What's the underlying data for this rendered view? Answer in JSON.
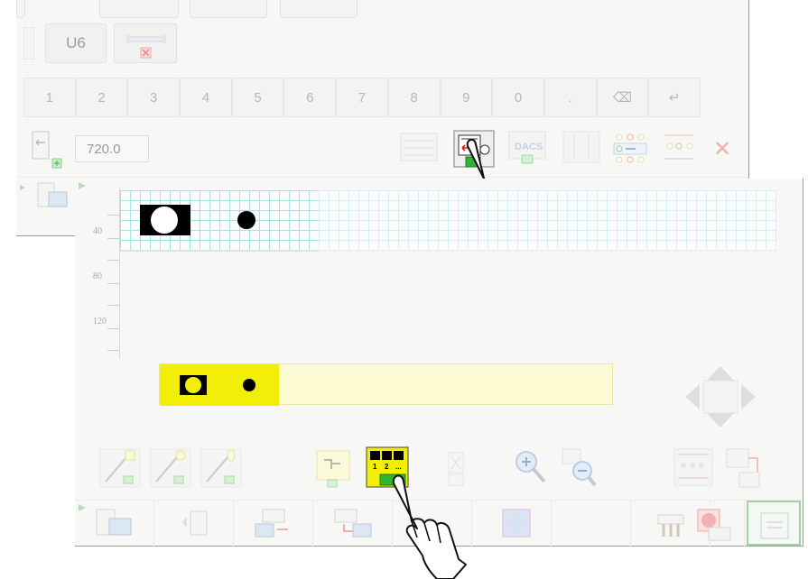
{
  "back_window": {
    "u6_button_label": "U6",
    "keypad": [
      "1",
      "2",
      "3",
      "4",
      "5",
      "6",
      "7",
      "8",
      "9",
      "0",
      ".",
      "⌫",
      "↵"
    ],
    "length_value": "720.0",
    "toolbar_icon_text": "DACS",
    "close_symbol": "✕"
  },
  "front_window": {
    "ruler_labels": [
      "40",
      "80",
      "120"
    ],
    "toolbar": {
      "order_numbers": [
        "1",
        "2",
        "..."
      ],
      "order_badge": "N"
    }
  },
  "colors": {
    "grid_line": "#a9e2e6",
    "highlight_yellow": "#f2ee08",
    "accent_green": "#2fb52f",
    "accent_red": "#d52020"
  }
}
